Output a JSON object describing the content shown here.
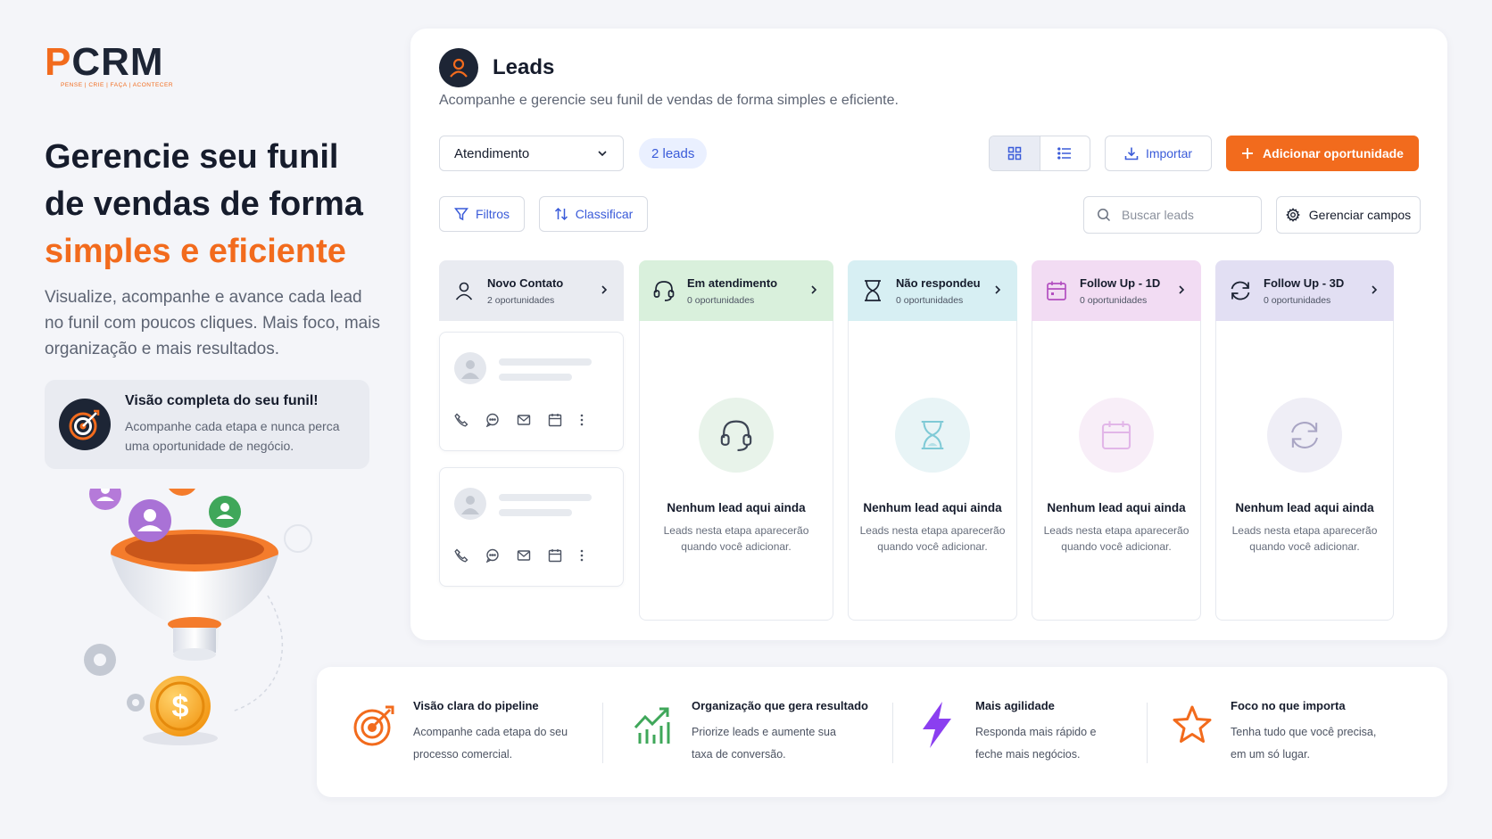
{
  "logo": {
    "text_p": "P",
    "text_rest": "CRM",
    "tagline": "PENSE | CRIE | FAÇA | ACONTECER"
  },
  "hero": {
    "title_line1": "Gerencie seu funil",
    "title_line2": "de vendas de forma",
    "title_accent": "simples e eficiente",
    "description": "Visualize, acompanhe e avance cada lead no funil com poucos cliques. Mais foco, mais organização e mais resultados."
  },
  "feature_box": {
    "title": "Visão completa do seu funil!",
    "text": "Acompanhe cada etapa e nunca perca uma oportunidade de negócio."
  },
  "header": {
    "title": "Leads",
    "subtitle": "Acompanhe e gerencie seu funil de vendas de forma simples e eficiente."
  },
  "toolbar": {
    "stage_select": "Atendimento",
    "lead_count": "2 leads",
    "import_label": "Importar",
    "add_label": "Adicionar oportunidade",
    "filter_label": "Filtros",
    "sort_label": "Classificar",
    "search_placeholder": "Buscar leads",
    "fields_label": "Gerenciar campos"
  },
  "columns": [
    {
      "name": "Novo Contato",
      "count": "2 oportunidades",
      "color": "#e9ebf1",
      "icon": "user-icon"
    },
    {
      "name": "Em atendimento",
      "count": "0 oportunidades",
      "color": "#d9f0dc",
      "icon": "headset-icon"
    },
    {
      "name": "Não respondeu",
      "count": "0 oportunidades",
      "color": "#d7eff3",
      "icon": "hourglass-icon"
    },
    {
      "name": "Follow Up - 1D",
      "count": "0 oportunidades",
      "color": "#f2dcf3",
      "icon": "calendar-icon"
    },
    {
      "name": "Follow Up - 3D",
      "count": "0 oportunidades",
      "color": "#e2dff3",
      "icon": "refresh-icon"
    }
  ],
  "empty_state": {
    "title": "Nenhum lead aqui ainda",
    "desc": "Leads nesta etapa aparecerão quando você adicionar."
  },
  "benefits": [
    {
      "title": "Visão clara do pipeline",
      "text": "Acompanhe cada etapa do seu processo comercial.",
      "icon": "target-icon"
    },
    {
      "title": "Organização que gera resultado",
      "text": "Priorize leads e aumente sua taxa de conversão.",
      "icon": "growth-chart-icon"
    },
    {
      "title": "Mais agilidade",
      "text": "Responda mais rápido e feche mais negócios.",
      "icon": "lightning-icon"
    },
    {
      "title": "Foco no que importa",
      "text": "Tenha tudo que você precisa, em um só lugar.",
      "icon": "star-icon"
    }
  ],
  "colors": {
    "brand": "#f26b1d",
    "dark": "#1d2535",
    "link": "#3a5bd9"
  }
}
